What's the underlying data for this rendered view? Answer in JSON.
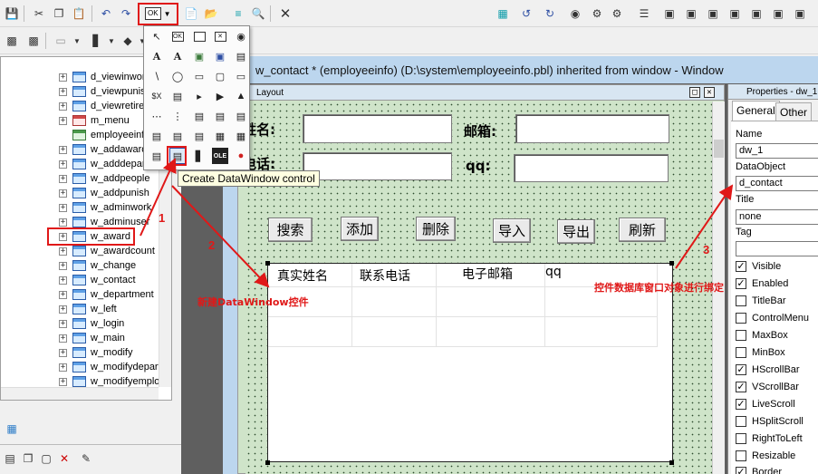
{
  "window": {
    "title": "w_contact * (employeeinfo) (D:\\system\\employeeinfo.pbl) inherited from window - Window"
  },
  "layout_pane": {
    "title": "Layout"
  },
  "form": {
    "name_label": "姓名:",
    "email_label": "邮箱:",
    "phone_label": "电话:",
    "qq_label": "qq:",
    "buttons": [
      "搜索",
      "添加",
      "删除",
      "导入",
      "导出",
      "刷新"
    ]
  },
  "datawindow": {
    "columns": [
      "真实姓名",
      "联系电话",
      "电子邮箱",
      "qq"
    ]
  },
  "palette": {
    "selected_control_label": "OK",
    "tooltip": "Create DataWindow control"
  },
  "tree": {
    "items": [
      {
        "label": "d_viewinwork",
        "icon": "datawindow-icon"
      },
      {
        "label": "d_viewpunish",
        "icon": "datawindow-icon"
      },
      {
        "label": "d_viewretire",
        "icon": "datawindow-icon"
      },
      {
        "label": "m_menu",
        "icon": "menu-icon"
      },
      {
        "label": "employeeinfo",
        "icon": "application-icon"
      },
      {
        "label": "w_addaward",
        "icon": "window-icon"
      },
      {
        "label": "w_adddepart",
        "icon": "window-icon"
      },
      {
        "label": "w_addpeople",
        "icon": "window-icon"
      },
      {
        "label": "w_addpunish",
        "icon": "window-icon"
      },
      {
        "label": "w_adminwork",
        "icon": "window-icon"
      },
      {
        "label": "w_adminuser",
        "icon": "window-icon"
      },
      {
        "label": "w_award",
        "icon": "window-icon"
      },
      {
        "label": "w_awardcount",
        "icon": "window-icon"
      },
      {
        "label": "w_change",
        "icon": "window-icon"
      },
      {
        "label": "w_contact",
        "icon": "window-icon"
      },
      {
        "label": "w_department",
        "icon": "window-icon"
      },
      {
        "label": "w_left",
        "icon": "window-icon"
      },
      {
        "label": "w_login",
        "icon": "window-icon"
      },
      {
        "label": "w_main",
        "icon": "window-icon"
      },
      {
        "label": "w_modify",
        "icon": "window-icon"
      },
      {
        "label": "w_modifydepart",
        "icon": "window-icon"
      },
      {
        "label": "w_modifyemploy",
        "icon": "window-icon"
      }
    ]
  },
  "properties": {
    "header": "Properties - dw_1 in",
    "tabs": [
      "General",
      "Other"
    ],
    "name_label": "Name",
    "name_value": "dw_1",
    "dataobject_label": "DataObject",
    "dataobject_value": "d_contact",
    "title_label": "Title",
    "title_value": "none",
    "tag_label": "Tag",
    "tag_value": "",
    "checkboxes": [
      {
        "label": "Visible",
        "checked": true
      },
      {
        "label": "Enabled",
        "checked": true
      },
      {
        "label": "TitleBar",
        "checked": false
      },
      {
        "label": "ControlMenu",
        "checked": false
      },
      {
        "label": "MaxBox",
        "checked": false
      },
      {
        "label": "MinBox",
        "checked": false
      },
      {
        "label": "HScrollBar",
        "checked": true
      },
      {
        "label": "VScrollBar",
        "checked": true
      },
      {
        "label": "LiveScroll",
        "checked": true
      },
      {
        "label": "HSplitScroll",
        "checked": false
      },
      {
        "label": "RightToLeft",
        "checked": false
      },
      {
        "label": "Resizable",
        "checked": false
      },
      {
        "label": "Border",
        "checked": true
      }
    ]
  },
  "annotations": {
    "step1": "1",
    "step2": "2",
    "step3": "3",
    "note2": "新建DataWindow控件",
    "note3": "控件数据库窗口对象进行绑定"
  },
  "colors": {
    "annotation": "#e01818",
    "design_bg": "#cfe4c9",
    "title_bar": "#bcd6ee"
  }
}
